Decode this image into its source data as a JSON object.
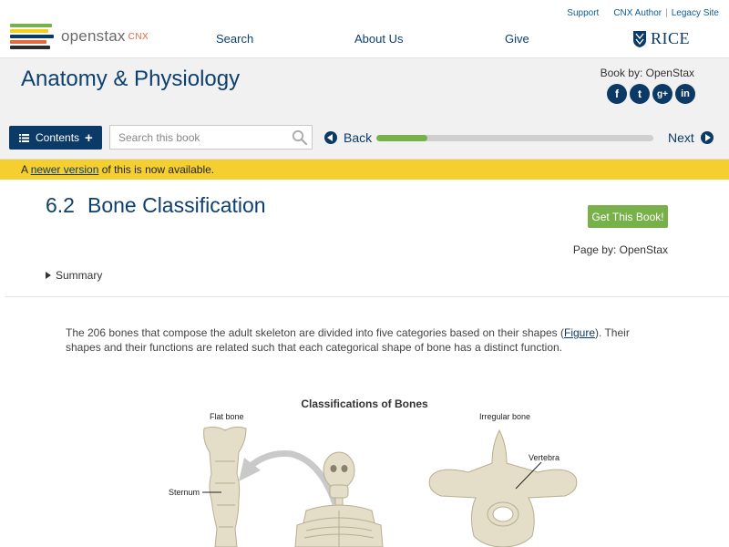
{
  "header": {
    "logo": {
      "brand": "openstax",
      "sub": "CNX"
    },
    "nav": [
      "Search",
      "About Us",
      "Give"
    ],
    "util_links": {
      "support": "Support",
      "author": "CNX Author",
      "sep": "|",
      "legacy": "Legacy Site"
    },
    "partner": "RICE"
  },
  "book": {
    "title": "Anatomy & Physiology",
    "by": "Book by: OpenStax",
    "social": [
      {
        "icon": "facebook-icon",
        "glyph": "f"
      },
      {
        "icon": "twitter-icon",
        "glyph": "t"
      },
      {
        "icon": "google-plus-icon",
        "glyph": "g+"
      },
      {
        "icon": "linkedin-icon",
        "glyph": "in"
      }
    ]
  },
  "toolbar": {
    "contents_label": "Contents",
    "search_placeholder": "Search this book",
    "back_label": "Back",
    "next_label": "Next",
    "progress": 0.185
  },
  "notice": {
    "prefix": "A ",
    "link": "newer version",
    "suffix": " of this is now available."
  },
  "page": {
    "section_number": "6.2",
    "section_title": "Bone Classification",
    "get_book_label": "Get This Book!",
    "page_by": "Page by: OpenStax",
    "summary_label": "Summary",
    "paragraph": {
      "before": "The 206 bones that compose the adult skeleton are divided into five categories based on their shapes (",
      "link": "Figure",
      "after": "). Their shapes and their functions are related such that each categorical shape of bone has a distinct function."
    }
  },
  "figure": {
    "title": "Classifications of Bones",
    "labels": {
      "flat_bone": "Flat bone",
      "sternum": "Sternum",
      "irregular_bone": "Irregular bone",
      "vertebra": "Vertebra"
    }
  },
  "colors": {
    "brand_blue": "#0c3a66",
    "accent_green": "#78b04a",
    "notice_yellow": "#f5cf2f",
    "bone": "#e4ddc8"
  }
}
